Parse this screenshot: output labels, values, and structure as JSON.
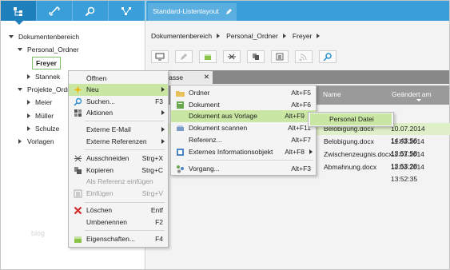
{
  "left_panel": {
    "tree": [
      {
        "label": "Dokumentenbereich"
      },
      {
        "label": "Personal_Ordner"
      },
      {
        "label": "Freyer"
      },
      {
        "label": "Stannek"
      },
      {
        "label": "Projekte_Ordn"
      },
      {
        "label": "Meier"
      },
      {
        "label": "Müller"
      },
      {
        "label": "Schulze"
      },
      {
        "label": "Vorlagen"
      }
    ],
    "watermark": "blog"
  },
  "right_panel": {
    "tab_title": "Standard-Listenlayout",
    "breadcrumb": [
      "Dokumentenbereich",
      "Personal_Ordner",
      "Freyer"
    ],
    "list_tab": "klasse",
    "columns": {
      "name": "Name",
      "changed": "Geändert am"
    },
    "rows": [
      {
        "name": "Belobigung.docx",
        "date": "10.07.2014 14:43:56"
      },
      {
        "name": "Belobigung.docx",
        "date": "11.03.2014 13:57:58"
      },
      {
        "name": "Zwischenzeugnis.docx",
        "date": "11.03.2014 13:53:28"
      },
      {
        "name": "Abmahnung.docx",
        "date": "11.03.2014 13:52:35"
      }
    ]
  },
  "context_menu": {
    "items": [
      {
        "label": "Öffnen",
        "shortcut": ""
      },
      {
        "label": "Neu",
        "shortcut": ""
      },
      {
        "label": "Suchen...",
        "shortcut": "F3"
      },
      {
        "label": "Aktionen",
        "shortcut": ""
      },
      {
        "label": "Externe E-Mail",
        "shortcut": ""
      },
      {
        "label": "Externe Referenzen",
        "shortcut": ""
      },
      {
        "label": "Ausschneiden",
        "shortcut": "Strg+X"
      },
      {
        "label": "Kopieren",
        "shortcut": "Strg+C"
      },
      {
        "label": "Als Referenz einfügen",
        "shortcut": ""
      },
      {
        "label": "Einfügen",
        "shortcut": "Strg+V"
      },
      {
        "label": "Löschen",
        "shortcut": "Entf"
      },
      {
        "label": "Umbenennen",
        "shortcut": "F2"
      },
      {
        "label": "Eigenschaften...",
        "shortcut": "F4"
      }
    ]
  },
  "submenu_neu": {
    "items": [
      {
        "label": "Ordner",
        "shortcut": "Alt+F5"
      },
      {
        "label": "Dokument",
        "shortcut": "Alt+F6"
      },
      {
        "label": "Dokument aus Vorlage",
        "shortcut": "Alt+F9"
      },
      {
        "label": "Dokument scannen",
        "shortcut": "Alt+F11"
      },
      {
        "label": "Referenz...",
        "shortcut": "Alt+F7"
      },
      {
        "label": "Externes Informationsobjekt",
        "shortcut": "Alt+F8"
      },
      {
        "label": "Vorgang...",
        "shortcut": "Alt+F3"
      }
    ]
  },
  "submenu_vorlage": {
    "items": [
      {
        "label": "Personal Datei"
      }
    ]
  },
  "colors": {
    "accent": "#3a9ed8",
    "highlight": "#c9e6a3"
  }
}
